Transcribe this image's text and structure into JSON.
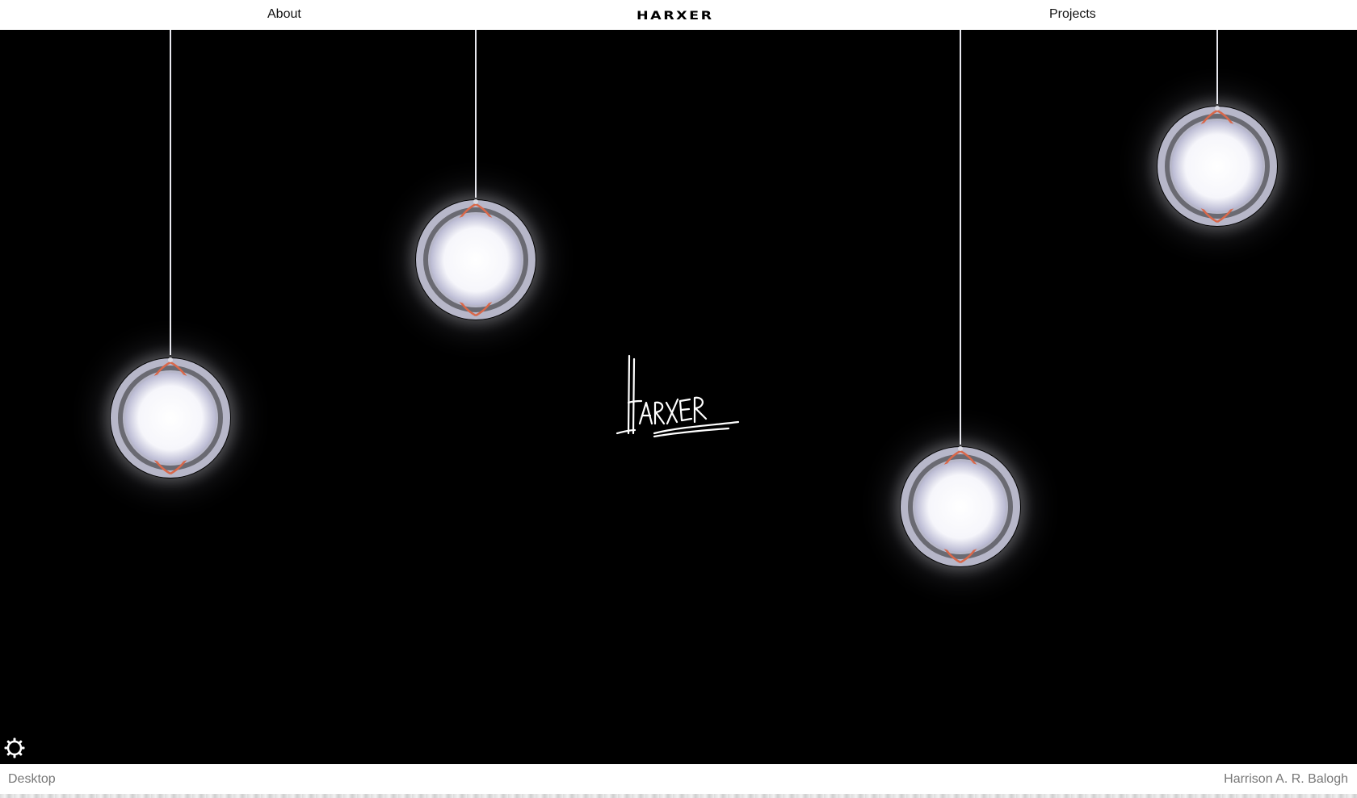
{
  "header": {
    "about_label": "About",
    "brand": "HARXER",
    "projects_label": "Projects"
  },
  "stage": {
    "signature_text": "Harxer",
    "lamps": [
      {
        "name": "lamp-left"
      },
      {
        "name": "lamp-center-left"
      },
      {
        "name": "lamp-center-right"
      },
      {
        "name": "lamp-right"
      }
    ],
    "colors": {
      "background": "#000000",
      "lamp_glow": "#ffffff",
      "lamp_shell": "#b4b4c8",
      "lamp_accent": "#d9684a"
    }
  },
  "controls": {
    "settings_icon": "gear-icon"
  },
  "footer": {
    "left_label": "Desktop",
    "right_label": "Harrison A. R. Balogh"
  }
}
